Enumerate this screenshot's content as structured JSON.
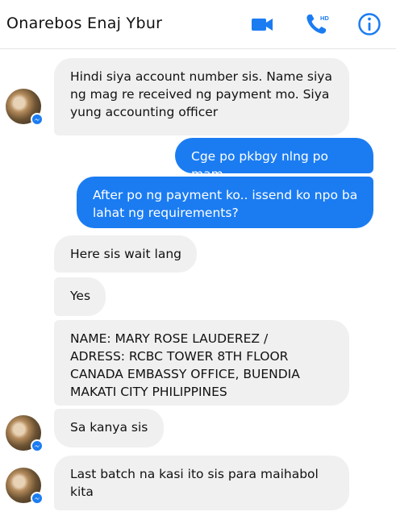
{
  "header": {
    "title": "Onarebos Enaj Ybur",
    "icons": {
      "video": "video-call-icon",
      "call": "phone-call-icon",
      "call_badge": "HD",
      "info": "info-icon"
    },
    "accent": "#1b7cf2"
  },
  "messages": [
    {
      "from": "them",
      "text": "Hindi siya account number sis. Name siya\nng mag re received ng payment mo. Siya\nyung accounting officer"
    },
    {
      "from": "me",
      "text": "Cge po pkbgy nlng po mam"
    },
    {
      "from": "me",
      "text": "After po ng payment ko.. issend ko npo ba\nlahat ng requirements?"
    },
    {
      "from": "them",
      "text": "Here sis wait lang"
    },
    {
      "from": "them",
      "text": "Yes"
    },
    {
      "from": "them",
      "text": "NAME: MARY ROSE LAUDEREZ /\nADRESS: RCBC TOWER 8TH FLOOR\nCANADA EMBASSY OFFICE, BUENDIA\nMAKATI CITY PHILIPPINES"
    },
    {
      "from": "them",
      "text": "Sa kanya sis"
    },
    {
      "from": "them",
      "text": "Last batch na kasi ito sis para maihabol\nkita"
    }
  ],
  "colors": {
    "incoming_bubble": "#f0f0f0",
    "outgoing_bubble": "#1b7cf2"
  }
}
